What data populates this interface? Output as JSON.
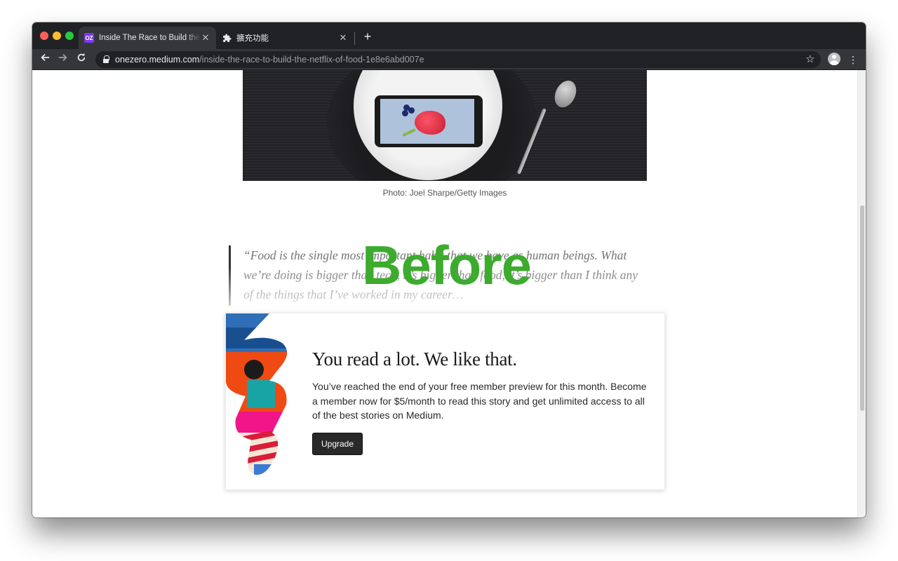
{
  "browser": {
    "tabs": [
      {
        "title": "Inside The Race to Build the Netflix of Food",
        "favicon": "OZ",
        "active": true
      },
      {
        "title": "擴充功能",
        "favicon": "puzzle-icon",
        "active": false
      }
    ],
    "url_host": "onezero.medium.com",
    "url_path": "/inside-the-race-to-build-the-netflix-of-food-1e8e6abd007e"
  },
  "article": {
    "photo_caption": "Photo: Joel Sharpe/Getty Images",
    "quote": "“Food is the single most important habit that we have as human beings. What we’re doing is bigger than tech, it’s bigger than food, it’s bigger than I think any of the things that I’ve worked in my career…"
  },
  "overlay_label": "Before",
  "paywall": {
    "title": "You read a lot. We like that.",
    "body": "You’ve reached the end of your free member preview for this month. Become a member now for $5/month to read this story and get unlimited access to all of the best stories on Medium.",
    "button_label": "Upgrade"
  },
  "colors": {
    "overlay_label": "#3cab2e",
    "tab_strip": "#202124",
    "toolbar": "#35363a",
    "button": "#292929"
  }
}
